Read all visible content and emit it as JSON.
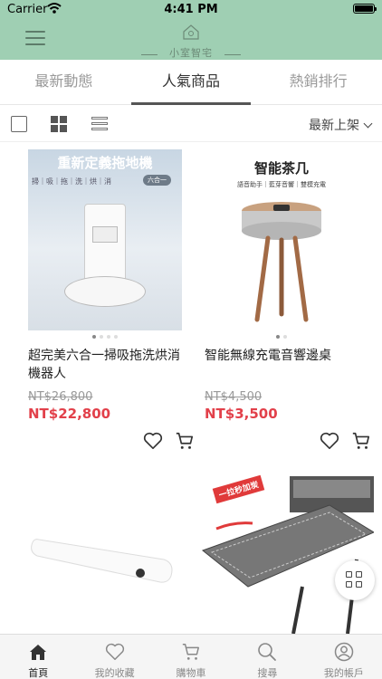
{
  "status_bar": {
    "carrier": "Carrier",
    "time": "4:41 PM"
  },
  "header": {
    "logo_text": "小室智宅"
  },
  "tabs": [
    {
      "label": "最新動態",
      "active": false
    },
    {
      "label": "人氣商品",
      "active": true
    },
    {
      "label": "熱銷排行",
      "active": false
    }
  ],
  "toolbar": {
    "sort_label": "最新上架"
  },
  "products": [
    {
      "image_title": "重新定義拖地機",
      "image_subtitle": "掃｜吸｜拖｜洗｜烘｜消",
      "image_badge": "六合一",
      "name": "超完美六合一掃吸拖洗烘消機器人",
      "original_price": "NT$26,800",
      "price": "NT$22,800"
    },
    {
      "image_title": "智能茶几",
      "image_subtitle": "語音助手｜藍芽音響｜雙模充電",
      "name": "智能無線充電音響邊桌",
      "original_price": "NT$4,500",
      "price": "NT$3,500"
    },
    {
      "image_title": "",
      "name": "",
      "original_price": "",
      "price": ""
    },
    {
      "image_badge": "一拉秒加炭",
      "name": "",
      "original_price": "",
      "price": ""
    }
  ],
  "bottom_nav": [
    {
      "label": "首頁",
      "icon": "home-icon",
      "active": true
    },
    {
      "label": "我的收藏",
      "icon": "heart-icon",
      "active": false
    },
    {
      "label": "購物車",
      "icon": "cart-icon",
      "active": false
    },
    {
      "label": "搜尋",
      "icon": "search-icon",
      "active": false
    },
    {
      "label": "我的帳戶",
      "icon": "user-icon",
      "active": false
    }
  ],
  "colors": {
    "header_bg": "#9fcfb3",
    "price_red": "#e2404a"
  }
}
